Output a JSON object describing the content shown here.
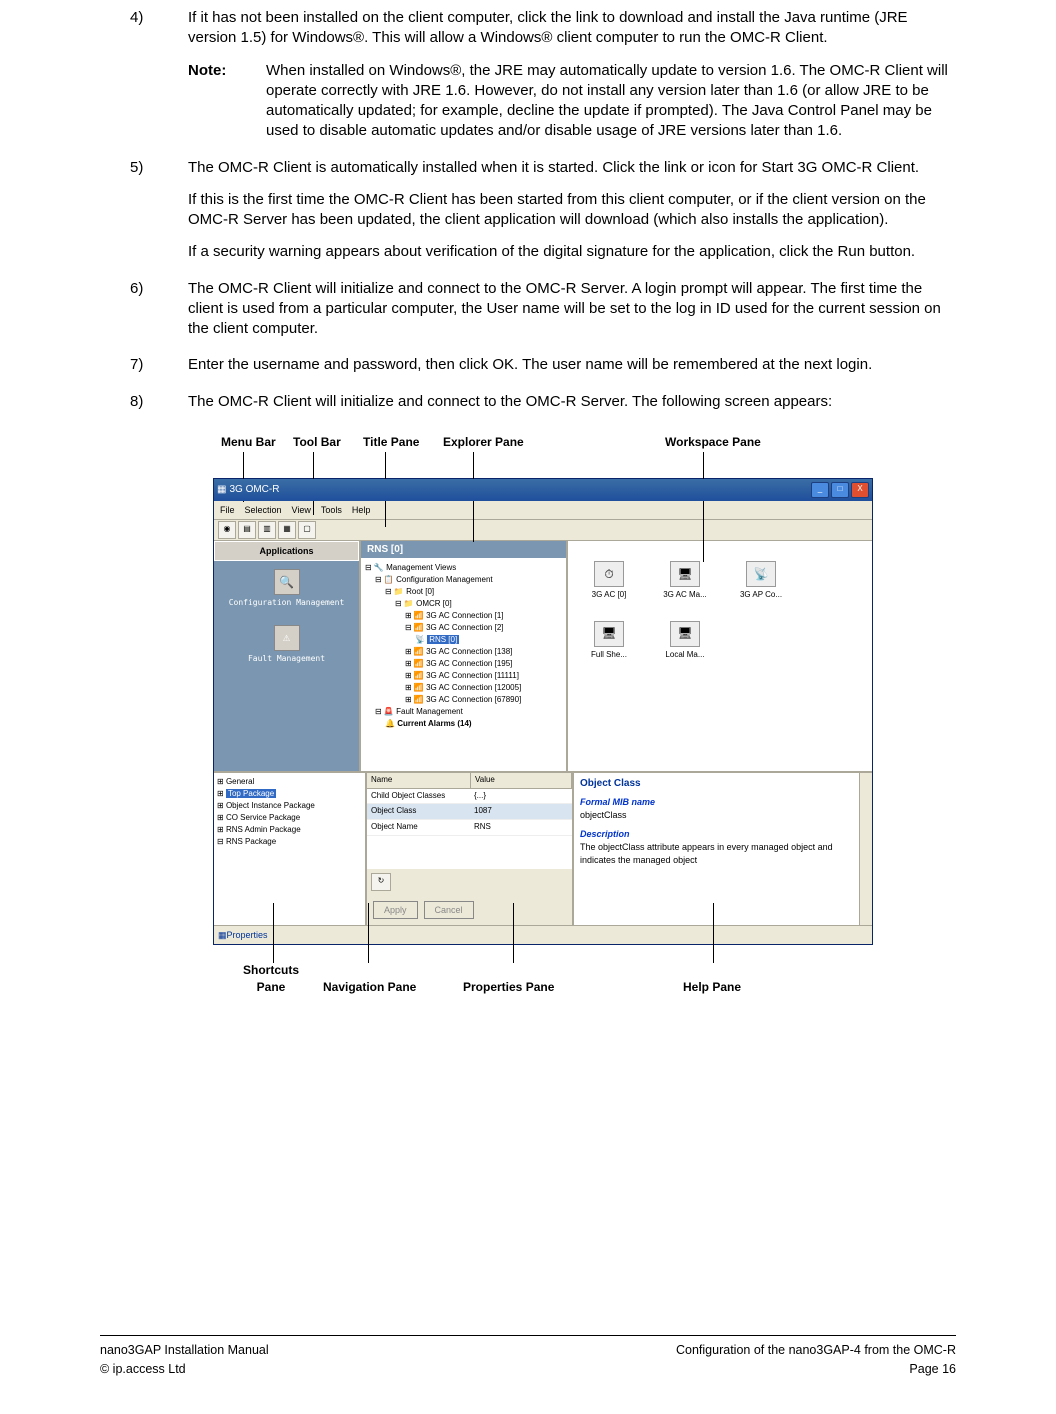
{
  "steps": {
    "s4": {
      "num": "4)",
      "text": "If it has not been installed on the client computer, click the link to download and install the Java runtime (JRE version 1.5) for Windows®. This will allow a Windows® client computer to run the OMC-R Client.",
      "note_label": "Note:",
      "note_text": "When installed on Windows®, the JRE may automatically update to version 1.6. The OMC-R Client will operate correctly with JRE 1.6. However, do not install any version later than 1.6 (or allow JRE to be automatically updated; for example, decline the update if prompted). The Java Control Panel may be used to disable automatic updates and/or disable usage of JRE versions later than 1.6."
    },
    "s5": {
      "num": "5)",
      "p1": "The OMC-R Client is automatically installed when it is started. Click the link or icon for Start 3G OMC-R Client.",
      "p2": "If this is the first time the OMC-R Client has been started from this client computer, or if the client version on the OMC-R Server has been updated, the client application will download (which also installs the application).",
      "p3": "If a security warning appears about verification of the digital signature for the application, click the Run button."
    },
    "s6": {
      "num": "6)",
      "text": "The OMC-R Client will initialize and connect to the OMC-R Server. A login prompt will appear. The first time the client is used from a particular computer, the User name will be set to the log in ID used for the current session on the client computer."
    },
    "s7": {
      "num": "7)",
      "text": "Enter the username and password, then click OK. The user name will be remembered at the next login."
    },
    "s8": {
      "num": "8)",
      "text": "The OMC-R Client will initialize and connect to the OMC-R Server. The following screen appears:"
    }
  },
  "callouts_top": {
    "menu": "Menu Bar",
    "tool": "Tool Bar",
    "title": "Title Pane",
    "explorer": "Explorer Pane",
    "workspace": "Workspace Pane"
  },
  "callouts_bottom": {
    "shortcuts": "Shortcuts\nPane",
    "nav": "Navigation Pane",
    "props": "Properties Pane",
    "help": "Help Pane"
  },
  "app": {
    "title": "3G OMC-R",
    "menu": {
      "file": "File",
      "selection": "Selection",
      "view": "View",
      "tools": "Tools",
      "help": "Help"
    },
    "shortcuts": {
      "header": "Applications",
      "item1": "Configuration Management",
      "item2": "Fault Management"
    },
    "explorer": {
      "title": "RNS [0]",
      "tree": {
        "l0": "Management Views",
        "l1": "Configuration Management",
        "l2": "Root [0]",
        "l3": "OMCR [0]",
        "l4": "3G AC Connection [1]",
        "l5": "3G AC Connection [2]",
        "l6": "RNS [0]",
        "l7": "3G AC Connection [138]",
        "l8": "3G AC Connection [195]",
        "l9": "3G AC Connection [11111]",
        "l10": "3G AC Connection [12005]",
        "l11": "3G AC Connection [67890]",
        "l12": "Fault Management",
        "l13": "Current Alarms (14)"
      }
    },
    "workspace": {
      "i1": "3G AC [0]",
      "i2": "3G AC Ma...",
      "i3": "3G AP Co...",
      "i4": "Full She...",
      "i5": "Local Ma..."
    },
    "nav": {
      "n1": "General",
      "n2": "Top Package",
      "n3": "Object Instance Package",
      "n4": "CO Service Package",
      "n5": "RNS Admin Package",
      "n6": "RNS Package"
    },
    "props": {
      "hdr_name": "Name",
      "hdr_val": "Value",
      "r1n": "Child Object Classes",
      "r1v": "{...}",
      "r2n": "Object Class",
      "r2v": "1087",
      "r3n": "Object Name",
      "r3v": "RNS",
      "apply": "Apply",
      "cancel": "Cancel"
    },
    "help": {
      "h1": "Object Class",
      "h2": "Formal MIB name",
      "t1": "objectClass",
      "h3": "Description",
      "t2": "The objectClass attribute appears in every managed object and indicates the managed object"
    },
    "status": "Properties"
  },
  "footer": {
    "left1": "nano3GAP Installation Manual",
    "right1": "Configuration of the nano3GAP-4 from the OMC-R",
    "left2": "© ip.access Ltd",
    "right2": "Page 16"
  }
}
